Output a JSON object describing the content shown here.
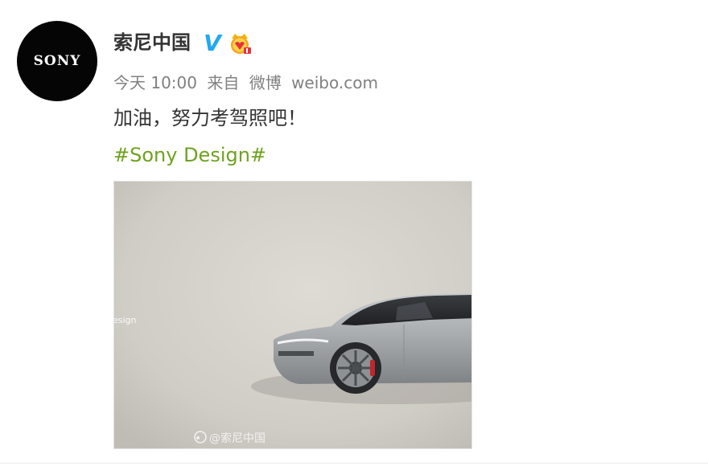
{
  "author": {
    "avatar_text": "SONY",
    "name": "索尼中国",
    "verified_badge": "V"
  },
  "meta": {
    "time": "今天 10:00",
    "source_prefix": "来自",
    "source_app": "微博",
    "source_domain": "weibo.com"
  },
  "post": {
    "text": "加油，努力考驾照吧！",
    "hashtag": "#Sony Design#"
  },
  "image": {
    "overlay_text": "esign",
    "watermark": "@索尼中国",
    "description_icon": "car-photo"
  },
  "colors": {
    "verified_blue": "#23a8f2",
    "hashtag_green": "#6fa21f",
    "meta_gray": "#808080"
  }
}
